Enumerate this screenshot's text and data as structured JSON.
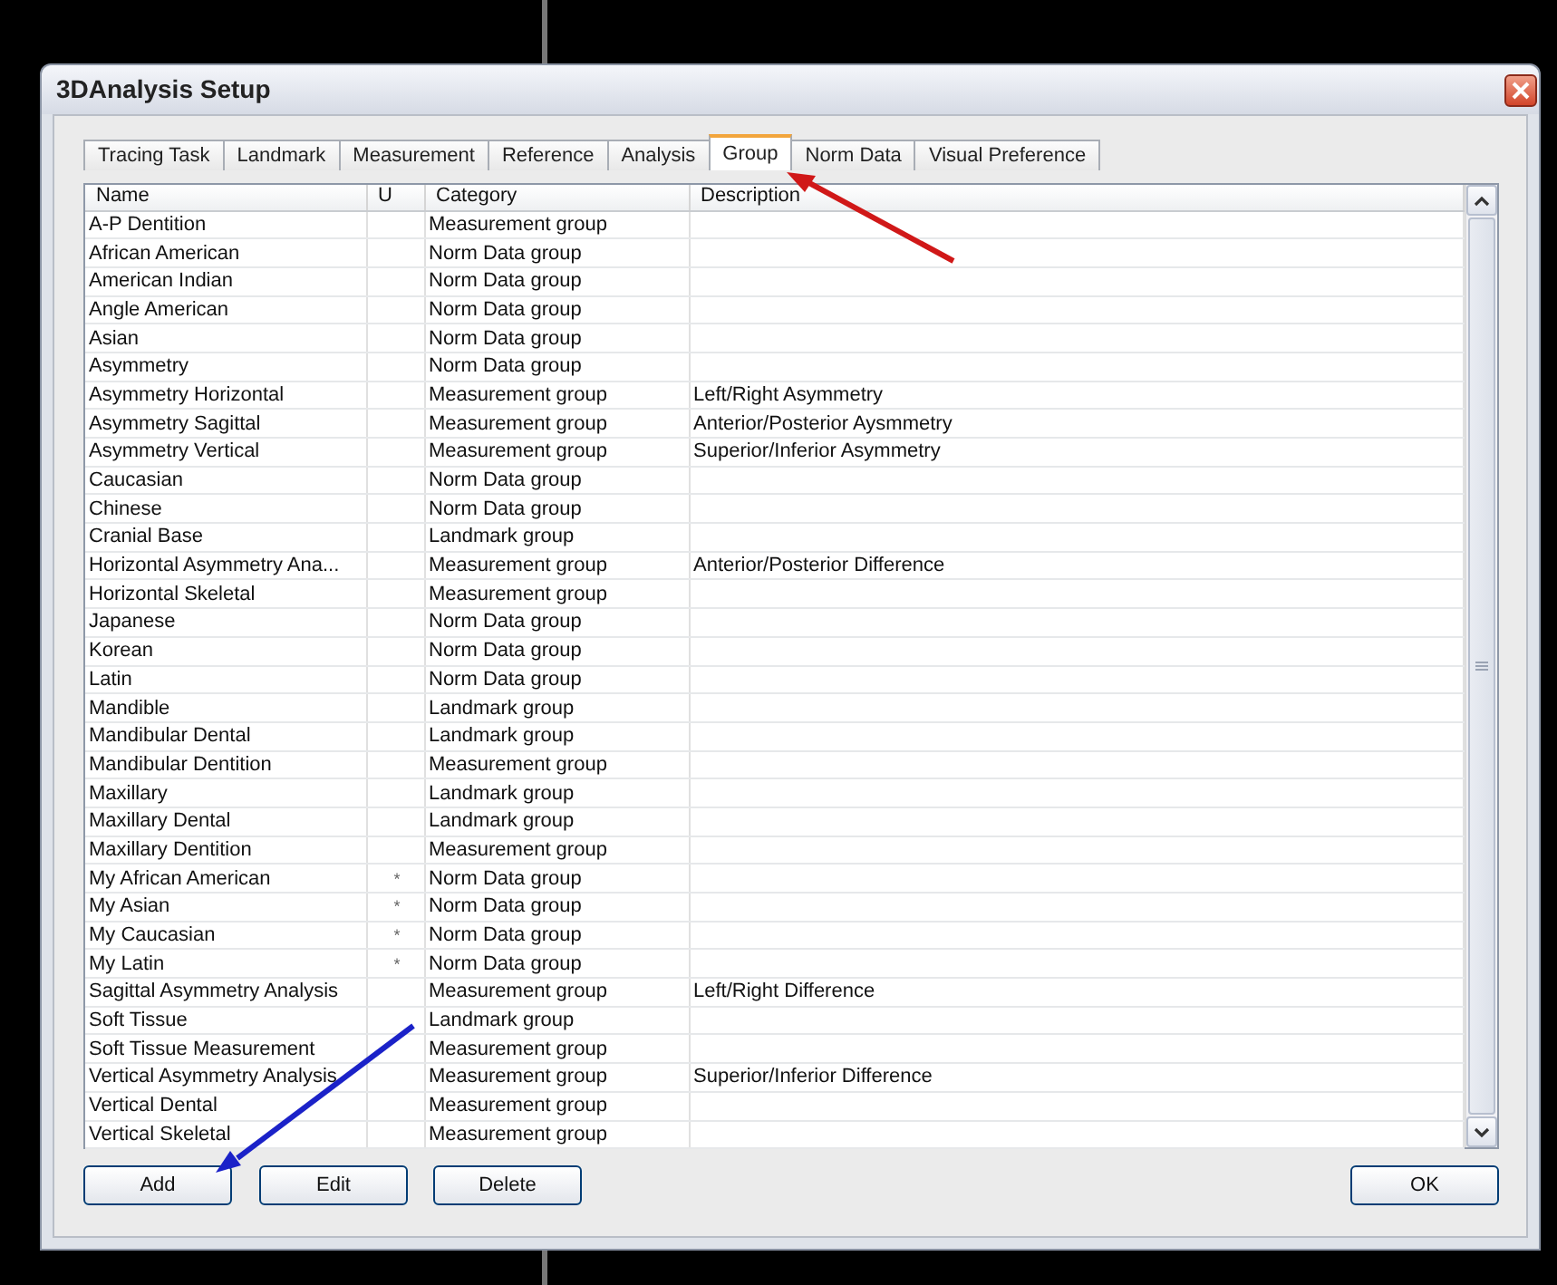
{
  "window": {
    "title": "3DAnalysis Setup"
  },
  "tabs": [
    {
      "label": "Tracing Task",
      "selected": false
    },
    {
      "label": "Landmark",
      "selected": false
    },
    {
      "label": "Measurement",
      "selected": false
    },
    {
      "label": "Reference",
      "selected": false
    },
    {
      "label": "Analysis",
      "selected": false
    },
    {
      "label": "Group",
      "selected": true
    },
    {
      "label": "Norm Data",
      "selected": false
    },
    {
      "label": "Visual Preference",
      "selected": false
    }
  ],
  "table": {
    "columns": [
      "Name",
      "U",
      "Category",
      "Description"
    ],
    "rows": [
      {
        "name": "A-P Dentition",
        "category": "Measurement group"
      },
      {
        "name": "African American",
        "category": "Norm Data group"
      },
      {
        "name": "American Indian",
        "category": "Norm Data group"
      },
      {
        "name": "Angle American",
        "category": "Norm Data group"
      },
      {
        "name": "Asian",
        "category": "Norm Data group"
      },
      {
        "name": "Asymmetry",
        "category": "Norm Data group"
      },
      {
        "name": "Asymmetry Horizontal",
        "category": "Measurement group",
        "description": "Left/Right Asymmetry"
      },
      {
        "name": "Asymmetry Sagittal",
        "category": "Measurement group",
        "description": "Anterior/Posterior Aysmmetry"
      },
      {
        "name": "Asymmetry Vertical",
        "category": "Measurement group",
        "description": "Superior/Inferior Asymmetry"
      },
      {
        "name": "Caucasian",
        "category": "Norm Data group"
      },
      {
        "name": "Chinese",
        "category": "Norm Data group"
      },
      {
        "name": "Cranial Base",
        "category": "Landmark group"
      },
      {
        "name": "Horizontal Asymmetry Ana...",
        "category": "Measurement group",
        "description": "Anterior/Posterior Difference"
      },
      {
        "name": "Horizontal Skeletal",
        "category": "Measurement group"
      },
      {
        "name": "Japanese",
        "category": "Norm Data group"
      },
      {
        "name": "Korean",
        "category": "Norm Data group"
      },
      {
        "name": "Latin",
        "category": "Norm Data group"
      },
      {
        "name": "Mandible",
        "category": "Landmark group"
      },
      {
        "name": "Mandibular Dental",
        "category": "Landmark group"
      },
      {
        "name": "Mandibular Dentition",
        "category": "Measurement group"
      },
      {
        "name": "Maxillary",
        "category": "Landmark group"
      },
      {
        "name": "Maxillary Dental",
        "category": "Landmark group"
      },
      {
        "name": "Maxillary Dentition",
        "category": "Measurement group"
      },
      {
        "name": "My African American",
        "u": "*",
        "category": "Norm Data group"
      },
      {
        "name": "My Asian",
        "u": "*",
        "category": "Norm Data group"
      },
      {
        "name": "My Caucasian",
        "u": "*",
        "category": "Norm Data group"
      },
      {
        "name": "My Latin",
        "u": "*",
        "category": "Norm Data group"
      },
      {
        "name": "Sagittal Asymmetry Analysis",
        "category": "Measurement group",
        "description": "Left/Right Difference"
      },
      {
        "name": "Soft Tissue",
        "category": "Landmark group"
      },
      {
        "name": "Soft Tissue Measurement",
        "category": "Measurement group"
      },
      {
        "name": "Vertical Asymmetry Analysis",
        "category": "Measurement group",
        "description": "Superior/Inferior Difference"
      },
      {
        "name": "Vertical Dental",
        "category": "Measurement group"
      },
      {
        "name": "Vertical Skeletal",
        "category": "Measurement group"
      }
    ]
  },
  "buttons": [
    {
      "label": "Add",
      "kind": "left"
    },
    {
      "label": "Edit",
      "kind": "left"
    },
    {
      "label": "Delete",
      "kind": "left"
    },
    {
      "label": "OK",
      "kind": "right"
    }
  ]
}
